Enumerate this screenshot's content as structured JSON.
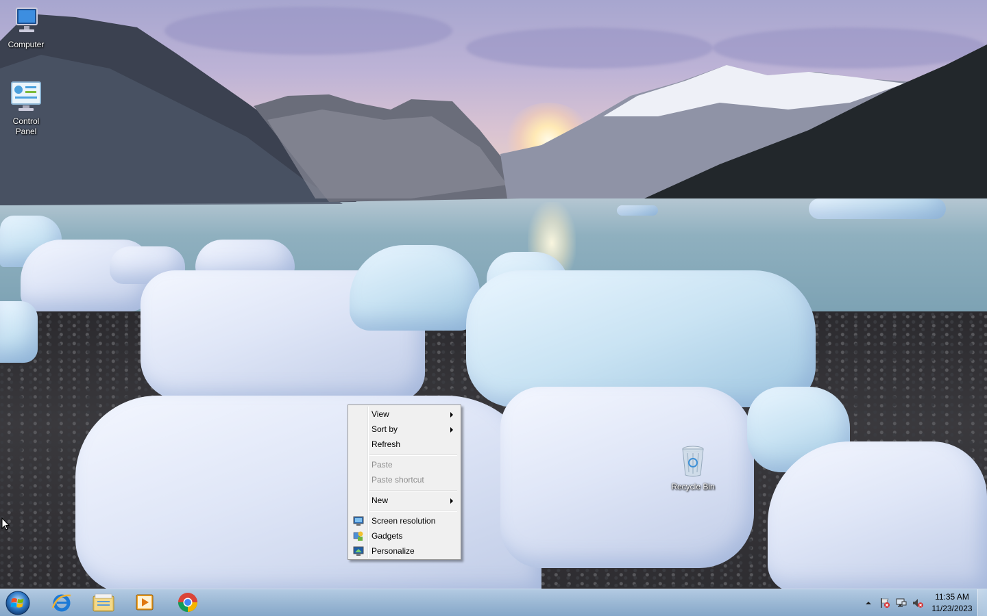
{
  "desktop": {
    "icons": [
      {
        "label_line1": "Computer",
        "label_line2": ""
      },
      {
        "label_line1": "Control",
        "label_line2": "Panel"
      },
      {
        "label_line1": "Recycle Bin",
        "label_line2": ""
      }
    ]
  },
  "context_menu": {
    "items": [
      {
        "label": "View",
        "has_submenu": true,
        "enabled": true
      },
      {
        "label": "Sort by",
        "has_submenu": true,
        "enabled": true
      },
      {
        "label": "Refresh",
        "has_submenu": false,
        "enabled": true
      },
      {
        "label": "Paste",
        "has_submenu": false,
        "enabled": false
      },
      {
        "label": "Paste shortcut",
        "has_submenu": false,
        "enabled": false
      },
      {
        "label": "New",
        "has_submenu": true,
        "enabled": true
      },
      {
        "label": "Screen resolution",
        "has_submenu": false,
        "enabled": true,
        "icon": "screen-resolution-icon"
      },
      {
        "label": "Gadgets",
        "has_submenu": false,
        "enabled": true,
        "icon": "gadgets-icon"
      },
      {
        "label": "Personalize",
        "has_submenu": false,
        "enabled": true,
        "icon": "personalize-icon"
      }
    ]
  },
  "taskbar": {
    "pinned": [
      {
        "icon": "internet-explorer-icon"
      },
      {
        "icon": "file-explorer-icon"
      },
      {
        "icon": "media-player-icon"
      },
      {
        "icon": "chrome-icon"
      }
    ],
    "tray": {
      "icons": [
        "show-hidden-icons-icon",
        "action-center-flag-icon",
        "network-icon",
        "volume-muted-icon"
      ],
      "time": "11:35 AM",
      "date": "11/23/2023"
    }
  },
  "colors": {
    "taskbar": "#96b4d2",
    "menu_bg": "#f0f0f0",
    "menu_disabled_text": "#8d8d8d"
  }
}
